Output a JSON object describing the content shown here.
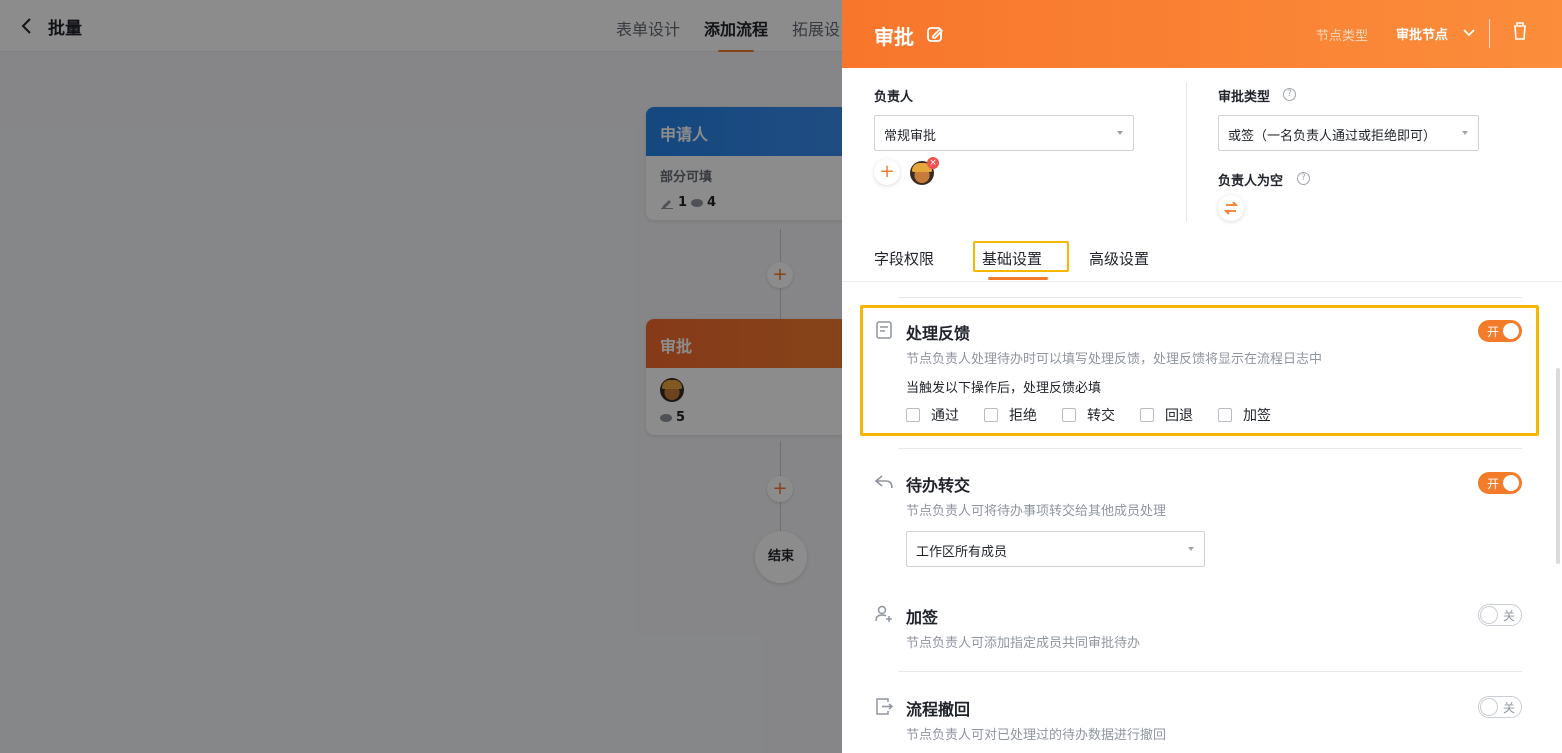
{
  "header": {
    "title": "批量",
    "tabs": [
      "表单设计",
      "添加流程",
      "拓展设"
    ]
  },
  "canvas": {
    "applicant_node": {
      "title": "申请人",
      "subtitle": "部分可填",
      "edit_count": "1",
      "view_count": "4"
    },
    "approval_node": {
      "title": "审批",
      "view_count": "5"
    },
    "end_label": "结束"
  },
  "drawer": {
    "title": "审批",
    "node_type_label": "节点类型",
    "node_type_value": "审批节点",
    "owner": {
      "label": "负责人",
      "select_value": "常规审批"
    },
    "approval_type": {
      "label": "审批类型",
      "select_value": "或签（一名负责人通过或拒绝即可）"
    },
    "owner_empty": {
      "label": "负责人为空"
    },
    "subtabs": [
      "字段权限",
      "基础设置",
      "高级设置"
    ],
    "feedback": {
      "title": "处理反馈",
      "desc": "节点负责人处理待办时可以填写处理反馈，处理反馈将显示在流程日志中",
      "toggle": "开",
      "trigger_label": "当触发以下操作后，处理反馈必填",
      "options": [
        "通过",
        "拒绝",
        "转交",
        "回退",
        "加签"
      ]
    },
    "transfer": {
      "title": "待办转交",
      "desc": "节点负责人可将待办事项转交给其他成员处理",
      "toggle": "开",
      "select_value": "工作区所有成员"
    },
    "countersign": {
      "title": "加签",
      "desc": "节点负责人可添加指定成员共同审批待办",
      "toggle": "关"
    },
    "withdraw": {
      "title": "流程撤回",
      "desc": "节点负责人可对已处理过的待办数据进行撤回",
      "toggle": "关"
    }
  },
  "colors": {
    "accent": "#f47b2a",
    "highlight": "#f5b800"
  }
}
